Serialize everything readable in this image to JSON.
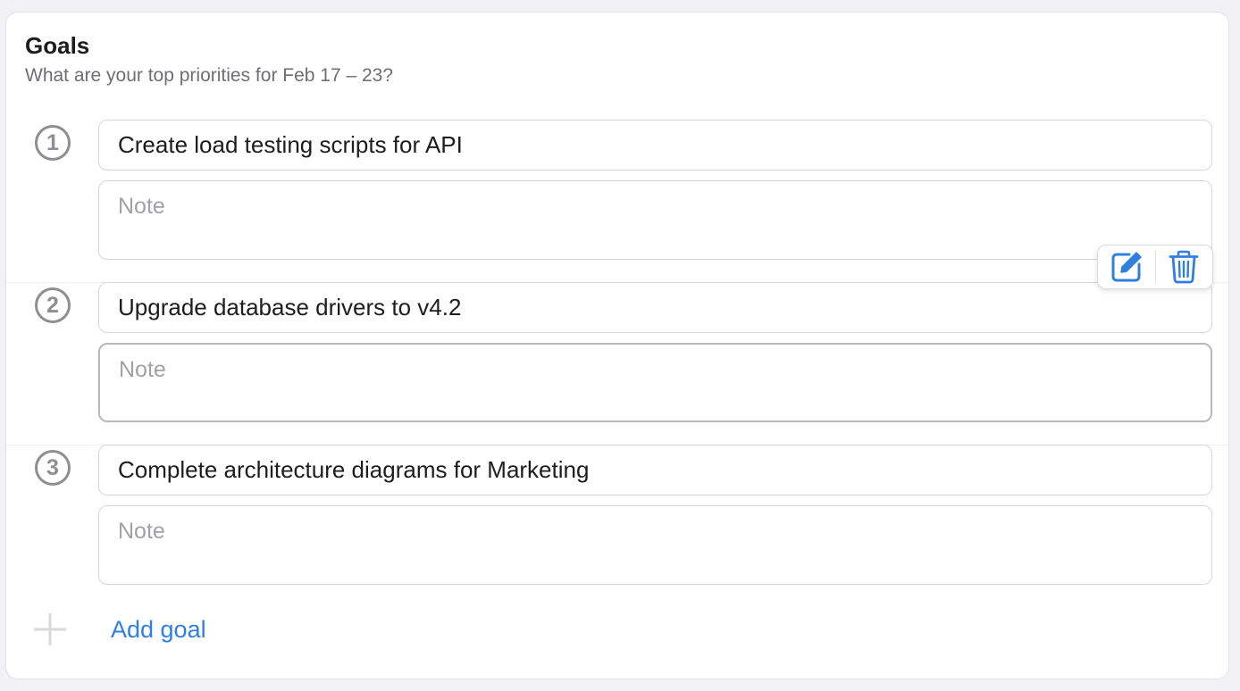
{
  "header": {
    "title": "Goals",
    "subtitle": "What are your top priorities for Feb 17 – 23?"
  },
  "goals": [
    {
      "number": "1",
      "value": "Create load testing scripts for API",
      "note_placeholder": "Note",
      "note_value": ""
    },
    {
      "number": "2",
      "value": "Upgrade database drivers to v4.2",
      "note_placeholder": "Note",
      "note_value": ""
    },
    {
      "number": "3",
      "value": "Complete architecture diagrams for Marketing",
      "note_placeholder": "Note",
      "note_value": ""
    }
  ],
  "toolbar": {
    "edit_icon": "edit-icon",
    "delete_icon": "trash-icon"
  },
  "add_goal": {
    "label": "Add goal",
    "icon": "plus-icon"
  },
  "colors": {
    "accent": "#2f7fe0",
    "muted": "#8e8e93",
    "border": "#d6d6da"
  }
}
